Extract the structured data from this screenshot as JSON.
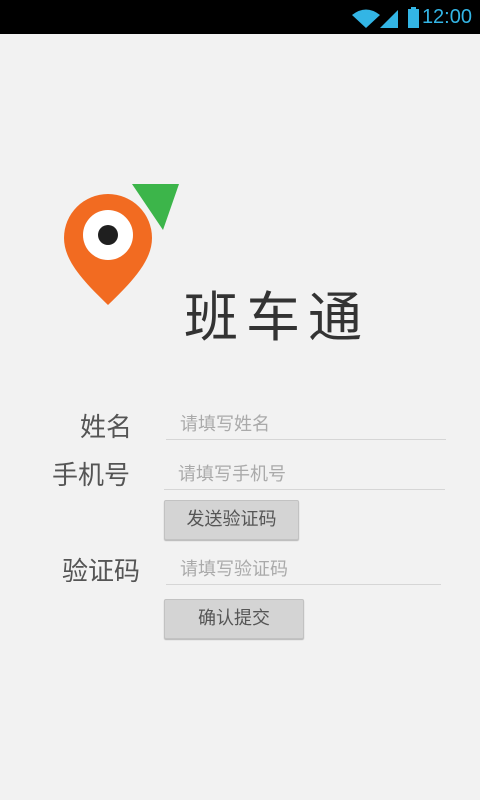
{
  "status_bar": {
    "time": "12:00",
    "icons": [
      "wifi-icon",
      "signal-icon",
      "battery-icon"
    ],
    "accent_color": "#33b5e5"
  },
  "app": {
    "title": "班车通",
    "logo_colors": {
      "pin": "#f26b21",
      "arrow": "#3cb54a"
    }
  },
  "form": {
    "name": {
      "label": "姓名",
      "value": "",
      "placeholder": "请填写姓名"
    },
    "phone": {
      "label": "手机号",
      "value": "",
      "placeholder": "请填写手机号"
    },
    "send_code_button": "发送验证码",
    "code": {
      "label": "验证码",
      "value": "",
      "placeholder": "请填写验证码"
    },
    "submit_button": "确认提交"
  }
}
